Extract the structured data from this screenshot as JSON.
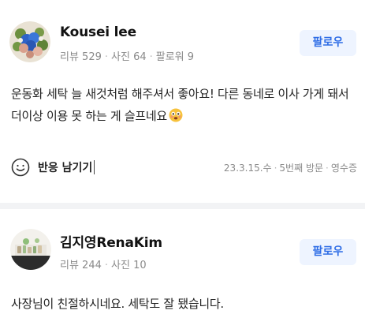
{
  "reviews": [
    {
      "name": "Kousei lee",
      "stats": {
        "reviews": "리뷰 529",
        "photos": "사진 64",
        "followers": "팔로워 9"
      },
      "follow_label": "팔로우",
      "text": "운동화 세탁 늘 새것처럼 해주셔서 좋아요! 다른 동네로 이사 가게 돼서 더이상 이용 못 하는 게 슬프네요",
      "emoji": "flushed-face-emoji",
      "react_label": "반응 남기기",
      "meta": {
        "date": "23.3.15.수",
        "visit": "5번째 방문",
        "receipt": "영수증"
      }
    },
    {
      "name": "김지영RenaKim",
      "stats": {
        "reviews": "리뷰 244",
        "photos": "사진 10"
      },
      "follow_label": "팔로우",
      "text": "사장님이 친절하시네요. 세탁도 잘 됐습니다."
    }
  ],
  "colors": {
    "accent": "#2f6de6",
    "button_bg": "#eef4ff",
    "muted": "#8a8a8a",
    "divider": "#f2f3f5"
  }
}
